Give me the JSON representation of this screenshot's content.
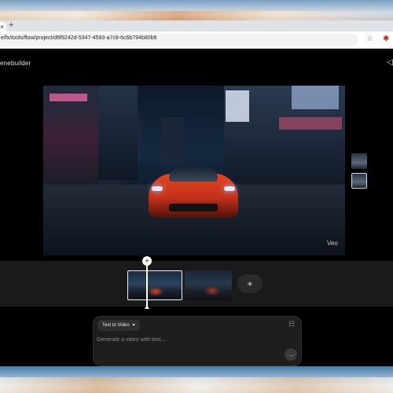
{
  "browser": {
    "tab_close_glyph": "×",
    "new_tab_glyph": "+",
    "url": "e/fx/tools/flow/project/d6f9242d-5347-4593-a7c8-6c6b794b80b6",
    "star_glyph": "☆",
    "extension_glyph": "✱"
  },
  "app": {
    "brand": "enebuilder",
    "top_right_glyph": "◁"
  },
  "preview": {
    "watermark": "Veo"
  },
  "timeline": {
    "playhead_glyph": "+",
    "add_clip_glyph": "+"
  },
  "prompt": {
    "mode_label": "Text to Video",
    "mode_caret": "▾",
    "placeholder": "Generate a video with text...",
    "settings_glyph": "☷",
    "send_glyph": "→"
  },
  "colors": {
    "background": "#000000",
    "timeline_bg": "#1a1a1a",
    "prompt_bg": "#1e1e1e",
    "car_accent": "#e2471f"
  },
  "icons": [
    "close-icon",
    "plus-icon",
    "star-icon",
    "extension-icon",
    "panel-icon",
    "settings-icon",
    "send-arrow-icon"
  ]
}
